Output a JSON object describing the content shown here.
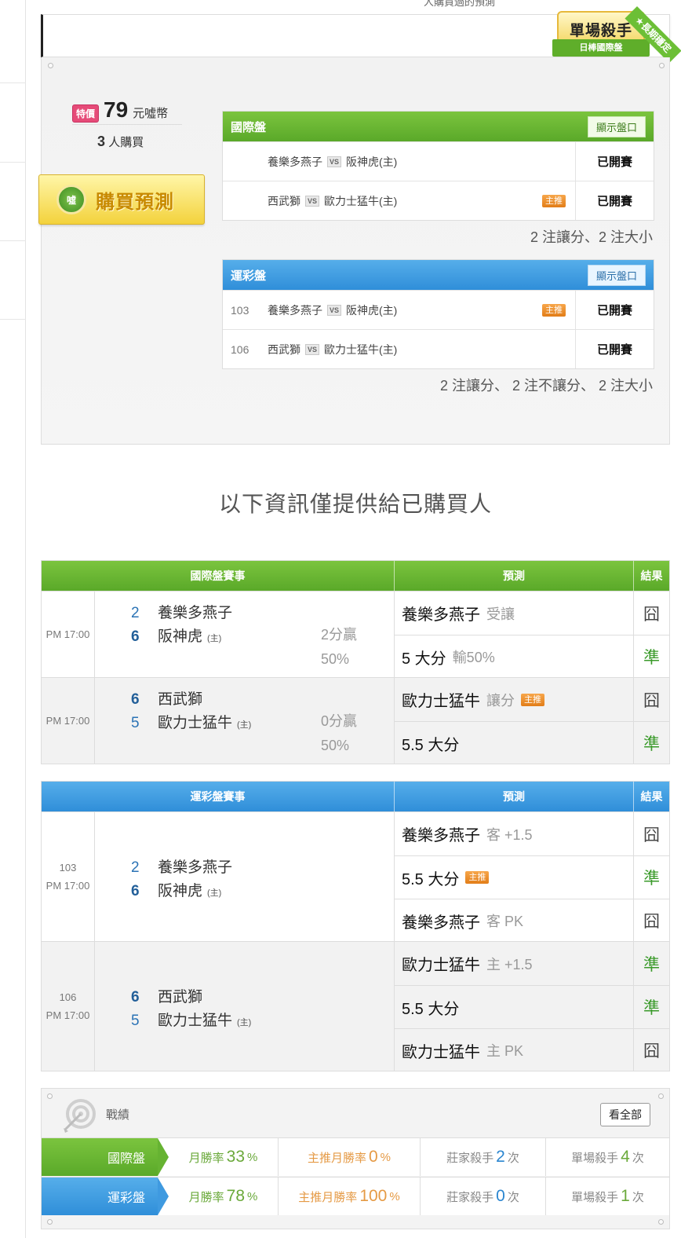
{
  "header": {
    "top_cut_text": "人購買過的預測",
    "badge_title": "單場殺手",
    "badge_subtitle": "日棒國際盤",
    "badge_corner": "★長期穩定"
  },
  "product": {
    "price_tag": "特價",
    "price": "79",
    "price_unit": "元噓幣",
    "buyers_count": "3",
    "buyers_suffix": "人購買",
    "buy_button_logo": "噓",
    "buy_button_label": "購買預測"
  },
  "intl_pan": {
    "title": "國際盤",
    "show_button": "顯示盤口",
    "rows": [
      {
        "code": "",
        "away": "養樂多燕子",
        "vs": "VS",
        "home": "阪神虎(主)",
        "zhutui": "",
        "status": "已開賽"
      },
      {
        "code": "",
        "away": "西武獅",
        "vs": "VS",
        "home": "歐力士猛牛(主)",
        "zhutui": "主推",
        "status": "已開賽"
      }
    ],
    "summary": "2 注讓分、2 注大小"
  },
  "lottery_pan": {
    "title": "運彩盤",
    "show_button": "顯示盤口",
    "rows": [
      {
        "code": "103",
        "away": "養樂多燕子",
        "vs": "VS",
        "home": "阪神虎(主)",
        "zhutui": "主推",
        "status": "已開賽"
      },
      {
        "code": "106",
        "away": "西武獅",
        "vs": "VS",
        "home": "歐力士猛牛(主)",
        "zhutui": "",
        "status": "已開賽"
      }
    ],
    "summary": "2 注讓分、 2 注不讓分、 2 注大小"
  },
  "info_title": "以下資訊僅提供給已購買人",
  "intl_table": {
    "headers": [
      "國際盤賽事",
      "預測",
      "結果"
    ],
    "groups": [
      {
        "code": "",
        "time": "PM 17:00",
        "away_score": "2",
        "away": "養樂多燕子",
        "home_score": "6",
        "home": "阪神虎",
        "home_mark": "(主)",
        "result_line1": "2分贏",
        "result_line2": "50%",
        "preds": [
          {
            "text": "養樂多燕子",
            "meta": "受讓",
            "zhutui": "",
            "result": "囧"
          },
          {
            "text": "5 大分",
            "meta": "輸50%",
            "zhutui": "",
            "result": "準"
          }
        ]
      },
      {
        "code": "",
        "time": "PM 17:00",
        "away_score": "6",
        "away": "西武獅",
        "home_score": "5",
        "home": "歐力士猛牛",
        "home_mark": "(主)",
        "result_line1": "0分贏",
        "result_line2": "50%",
        "preds": [
          {
            "text": "歐力士猛牛",
            "meta": "讓分",
            "zhutui": "主推",
            "result": "囧"
          },
          {
            "text": "5.5 大分",
            "meta": "",
            "zhutui": "",
            "result": "準"
          }
        ]
      }
    ]
  },
  "lottery_table": {
    "headers": [
      "運彩盤賽事",
      "預測",
      "結果"
    ],
    "groups": [
      {
        "code": "103",
        "time": "PM 17:00",
        "away_score": "2",
        "away": "養樂多燕子",
        "home_score": "6",
        "home": "阪神虎",
        "home_mark": "(主)",
        "preds": [
          {
            "text": "養樂多燕子",
            "meta": "客 +1.5",
            "zhutui": "",
            "result": "囧"
          },
          {
            "text": "5.5 大分",
            "meta": "",
            "zhutui": "主推",
            "result": "準"
          },
          {
            "text": "養樂多燕子",
            "meta": "客 PK",
            "zhutui": "",
            "result": "囧"
          }
        ]
      },
      {
        "code": "106",
        "time": "PM 17:00",
        "away_score": "6",
        "away": "西武獅",
        "home_score": "5",
        "home": "歐力士猛牛",
        "home_mark": "(主)",
        "preds": [
          {
            "text": "歐力士猛牛",
            "meta": "主 +1.5",
            "zhutui": "",
            "result": "準"
          },
          {
            "text": "5.5 大分",
            "meta": "",
            "zhutui": "",
            "result": "準"
          },
          {
            "text": "歐力士猛牛",
            "meta": "主 PK",
            "zhutui": "",
            "result": "囧"
          }
        ]
      }
    ]
  },
  "record": {
    "title": "戰績",
    "see_all": "看全部",
    "rows": [
      {
        "label": "國際盤",
        "color": "green",
        "monthly_label": "月勝率",
        "monthly": "33",
        "monthly_unit": "%",
        "main_label": "主推月勝率",
        "main": "0",
        "main_unit": "%",
        "house_label": "莊家殺手",
        "house": "2",
        "house_unit": "次",
        "single_label": "單場殺手",
        "single": "4",
        "single_unit": "次"
      },
      {
        "label": "運彩盤",
        "color": "blue",
        "monthly_label": "月勝率",
        "monthly": "78",
        "monthly_unit": "%",
        "main_label": "主推月勝率",
        "main": "100",
        "main_unit": "%",
        "house_label": "莊家殺手",
        "house": "0",
        "house_unit": "次",
        "single_label": "單場殺手",
        "single": "1",
        "single_unit": "次"
      }
    ]
  },
  "colors": {
    "green": "#5aa929",
    "blue": "#2f8ed9",
    "zhutui_orange": "#e27d18",
    "win_green": "#3a9a2a",
    "price_pink": "#e64b78"
  }
}
